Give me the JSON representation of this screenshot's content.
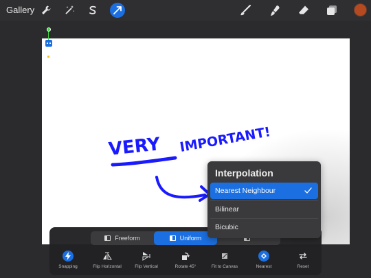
{
  "topbar": {
    "gallery_label": "Gallery",
    "left_tools": [
      "wrench-icon",
      "magic-wand-icon",
      "selection-s-icon",
      "transform-arrow-icon"
    ],
    "right_tools": [
      "brush-icon",
      "smudge-icon",
      "eraser-icon",
      "layers-icon"
    ],
    "current_color": "#b5491f"
  },
  "canvas": {
    "background": "#ffffff",
    "handwriting": {
      "text_line1": "VERY",
      "text_line2": "IMPORTANT!",
      "ink_color": "#1a1aff"
    }
  },
  "transform": {
    "modes": [
      {
        "label": "Freeform",
        "active": false
      },
      {
        "label": "Uniform",
        "active": true
      },
      {
        "label": "",
        "active": false
      }
    ],
    "tools": [
      {
        "label": "Snapping",
        "icon": "snapping-icon",
        "active": true
      },
      {
        "label": "Flip Horizontal",
        "icon": "flip-horizontal-icon",
        "active": false
      },
      {
        "label": "Flip Vertical",
        "icon": "flip-vertical-icon",
        "active": false
      },
      {
        "label": "Rotate 45°",
        "icon": "rotate-icon",
        "active": false
      },
      {
        "label": "Fit to Canvas",
        "icon": "fit-to-canvas-icon",
        "active": false
      },
      {
        "label": "Nearest",
        "icon": "interpolation-icon",
        "active": true
      },
      {
        "label": "Reset",
        "icon": "reset-icon",
        "active": false
      }
    ]
  },
  "interpolation_menu": {
    "title": "Interpolation",
    "options": [
      {
        "label": "Nearest Neighbour",
        "selected": true
      },
      {
        "label": "Bilinear",
        "selected": false
      },
      {
        "label": "Bicubic",
        "selected": false
      }
    ]
  },
  "colors": {
    "accent": "#1b6fe0",
    "toolbar_bg": "#2f2f31",
    "popup_bg": "#3a3a3c"
  }
}
